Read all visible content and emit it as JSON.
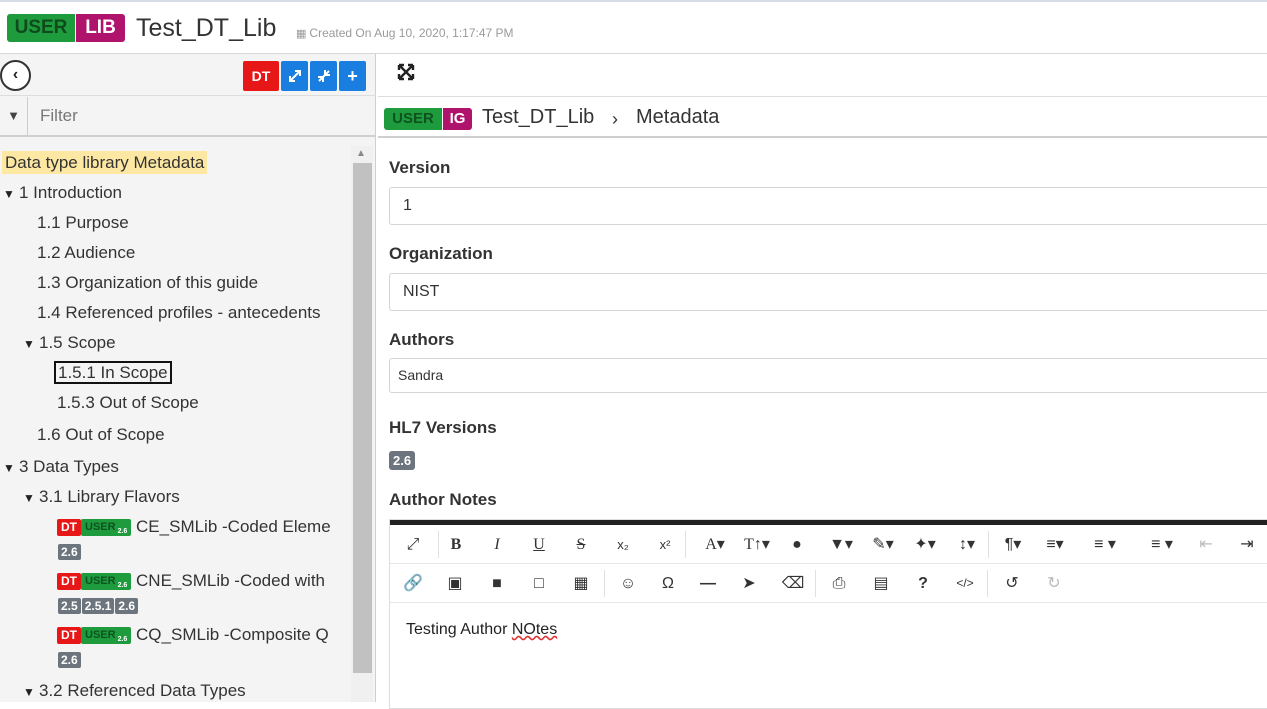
{
  "header": {
    "user_badge": "USER",
    "lib_badge": "LIB",
    "title": "Test_DT_Lib",
    "created": "Created On Aug 10, 2020, 1:17:47 PM"
  },
  "left_toolbar": {
    "dt_label": "DT",
    "add_label": "+"
  },
  "filter": {
    "placeholder": "Filter"
  },
  "tree": {
    "metadata": "Data type library Metadata",
    "intro": "1 Introduction",
    "purpose": "1.1 Purpose",
    "audience": "1.2 Audience",
    "organization": "1.3 Organization of this guide",
    "referenced": "1.4 Referenced profiles - antecedents",
    "scope": "1.5 Scope",
    "in_scope": "1.5.1 In Scope",
    "out_scope_153": "1.5.3 Out of Scope",
    "out_scope_16": "1.6 Out of Scope",
    "data_types": "3 Data Types",
    "library_flavors": "3.1 Library Flavors",
    "ref_data_types": "3.2 Referenced Data Types",
    "items": [
      {
        "dt": "DT",
        "user": "USER",
        "user_ver": "2.6",
        "name": "CE_SMLib -Coded Eleme",
        "versions": [
          "2.6"
        ]
      },
      {
        "dt": "DT",
        "user": "USER",
        "user_ver": "2.6",
        "name": "CNE_SMLib -Coded with",
        "versions": [
          "2.5",
          "2.5.1",
          "2.6"
        ]
      },
      {
        "dt": "DT",
        "user": "USER",
        "user_ver": "2.6",
        "name": "CQ_SMLib -Composite Q",
        "versions": [
          "2.6"
        ]
      }
    ]
  },
  "breadcrumb": {
    "user": "USER",
    "ig": "IG",
    "library": "Test_DT_Lib",
    "page": "Metadata"
  },
  "form": {
    "version_label": "Version",
    "version_value": "1",
    "organization_label": "Organization",
    "organization_value": "NIST",
    "authors_label": "Authors",
    "authors_value": "Sandra",
    "hl7_label": "HL7 Versions",
    "hl7_value": "2.6",
    "notes_label": "Author Notes",
    "notes_text_1": "Testing Author ",
    "notes_text_2": "NOtes"
  },
  "colors": {
    "user_green": "#1e9b3c",
    "lib_magenta": "#b0136b",
    "dt_red": "#e81717",
    "action_blue": "#1a7de0",
    "highlight_yellow": "#fde8a3"
  }
}
